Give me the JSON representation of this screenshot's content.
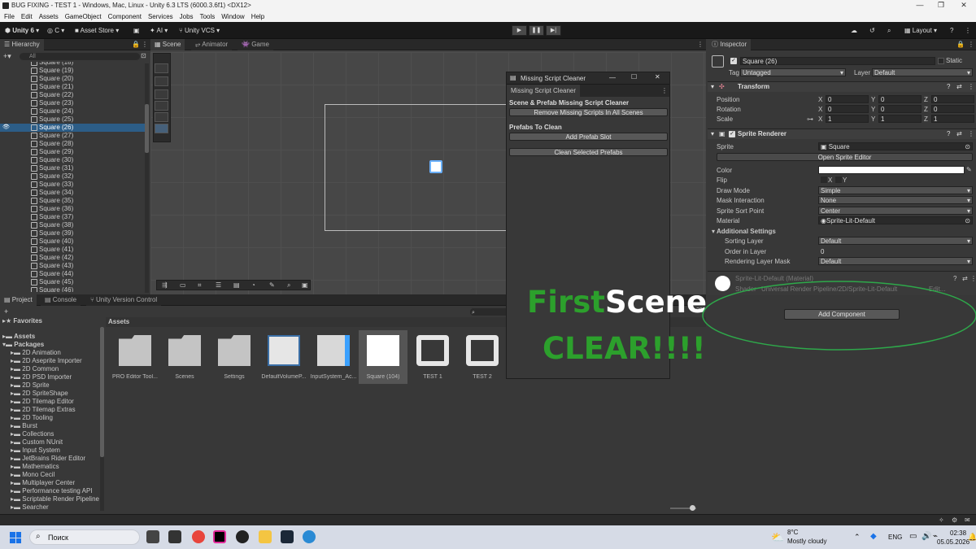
{
  "window": {
    "title": "BUG FIXING - TEST 1 - Windows, Mac, Linux - Unity 6.3 LTS (6000.3.6f1) <DX12>"
  },
  "menu": [
    "File",
    "Edit",
    "Assets",
    "GameObject",
    "Component",
    "Services",
    "Jobs",
    "Tools",
    "Window",
    "Help"
  ],
  "toolbar": {
    "account": "Unity 6",
    "cloud": "C",
    "asset_store": "Asset Store",
    "ai": "AI",
    "vcs": "Unity VCS",
    "layout": "Layout"
  },
  "hierarchy": {
    "tab": "Hierarchy",
    "search_placeholder": "All",
    "items": [
      "Square (18)",
      "Square (19)",
      "Square (20)",
      "Square (21)",
      "Square (22)",
      "Square (23)",
      "Square (24)",
      "Square (25)",
      "Square (26)",
      "Square (27)",
      "Square (28)",
      "Square (29)",
      "Square (30)",
      "Square (31)",
      "Square (32)",
      "Square (33)",
      "Square (34)",
      "Square (35)",
      "Square (36)",
      "Square (37)",
      "Square (38)",
      "Square (39)",
      "Square (40)",
      "Square (41)",
      "Square (42)",
      "Square (43)",
      "Square (44)",
      "Square (45)",
      "Square (46)"
    ],
    "selected": "Square (26)"
  },
  "scene_tabs": [
    "Scene",
    "Animator",
    "Game"
  ],
  "msc": {
    "title": "Missing Script Cleaner",
    "tab": "Missing Script Cleaner",
    "section1": "Scene & Prefab Missing Script Cleaner",
    "btn_remove": "Remove Missing Scripts In All Scenes",
    "section2": "Prefabs To Clean",
    "btn_add": "Add Prefab Slot",
    "btn_clean": "Clean Selected Prefabs"
  },
  "overlay": {
    "first": "First",
    "scene": "Scene-",
    "clear": "CLEAR!!!!"
  },
  "inspector": {
    "tab": "Inspector",
    "object_name": "Square (26)",
    "static_label": "Static",
    "tag_label": "Tag",
    "tag_value": "Untagged",
    "layer_label": "Layer",
    "layer_value": "Default",
    "transform": {
      "title": "Transform",
      "position_label": "Position",
      "rotation_label": "Rotation",
      "scale_label": "Scale",
      "position": [
        "0",
        "0",
        "0"
      ],
      "rotation": [
        "0",
        "0",
        "0"
      ],
      "scale": [
        "1",
        "1",
        "1"
      ],
      "axes": [
        "X",
        "Y",
        "Z"
      ]
    },
    "sprite_renderer": {
      "title": "Sprite Renderer",
      "sprite_label": "Sprite",
      "sprite_value": "Square",
      "open_editor": "Open Sprite Editor",
      "color_label": "Color",
      "flip_label": "Flip",
      "flip_x": "X",
      "flip_y": "Y",
      "draw_mode_label": "Draw Mode",
      "draw_mode": "Simple",
      "mask_label": "Mask Interaction",
      "mask": "None",
      "sort_point_label": "Sprite Sort Point",
      "sort_point": "Center",
      "material_label": "Material",
      "material": "Sprite-Lit-Default",
      "additional": "Additional Settings",
      "sorting_layer_label": "Sorting Layer",
      "sorting_layer": "Default",
      "order_label": "Order in Layer",
      "order": "0",
      "rendering_mask_label": "Rendering Layer Mask",
      "rendering_mask": "Default"
    },
    "material": {
      "name": "Sprite-Lit-Default (Material)",
      "shader_label": "Shader",
      "shader": "Universal Render Pipeline/2D/Sprite-Lit-Default",
      "edit": "Edit..."
    },
    "add_component": "Add Component"
  },
  "project": {
    "tabs": [
      "Project",
      "Console",
      "Unity Version Control"
    ],
    "favorites": "Favorites",
    "assets_root": "Assets",
    "packages_root": "Packages",
    "packages": [
      "2D Animation",
      "2D Aseprite Importer",
      "2D Common",
      "2D PSD Importer",
      "2D Sprite",
      "2D SpriteShape",
      "2D Tilemap Editor",
      "2D Tilemap Extras",
      "2D Tooling",
      "Burst",
      "Collections",
      "Custom NUnit",
      "Input System",
      "JetBrains Rider Editor",
      "Mathematics",
      "Mono Cecil",
      "Multiplayer Center",
      "Performance testing API",
      "Scriptable Render Pipeline",
      "Searcher"
    ],
    "breadcrumb": "Assets",
    "assets": [
      "PRO Editor Tool...",
      "Scenes",
      "Settings",
      "DefaultVolumeP...",
      "InputSystem_Ac...",
      "Square (104)",
      "TEST 1",
      "TEST 2",
      "UniversalRende..."
    ],
    "count": "29"
  },
  "taskbar": {
    "search": "Поиск",
    "weather_temp": "8°C",
    "weather_desc": "Mostly cloudy",
    "lang": "ENG",
    "time": "02:38",
    "date": "05.05.2026"
  },
  "colors": {
    "selection": "#2c5d87",
    "overlay_green": "#2ca02c",
    "ellipse": "#2ea84a"
  }
}
